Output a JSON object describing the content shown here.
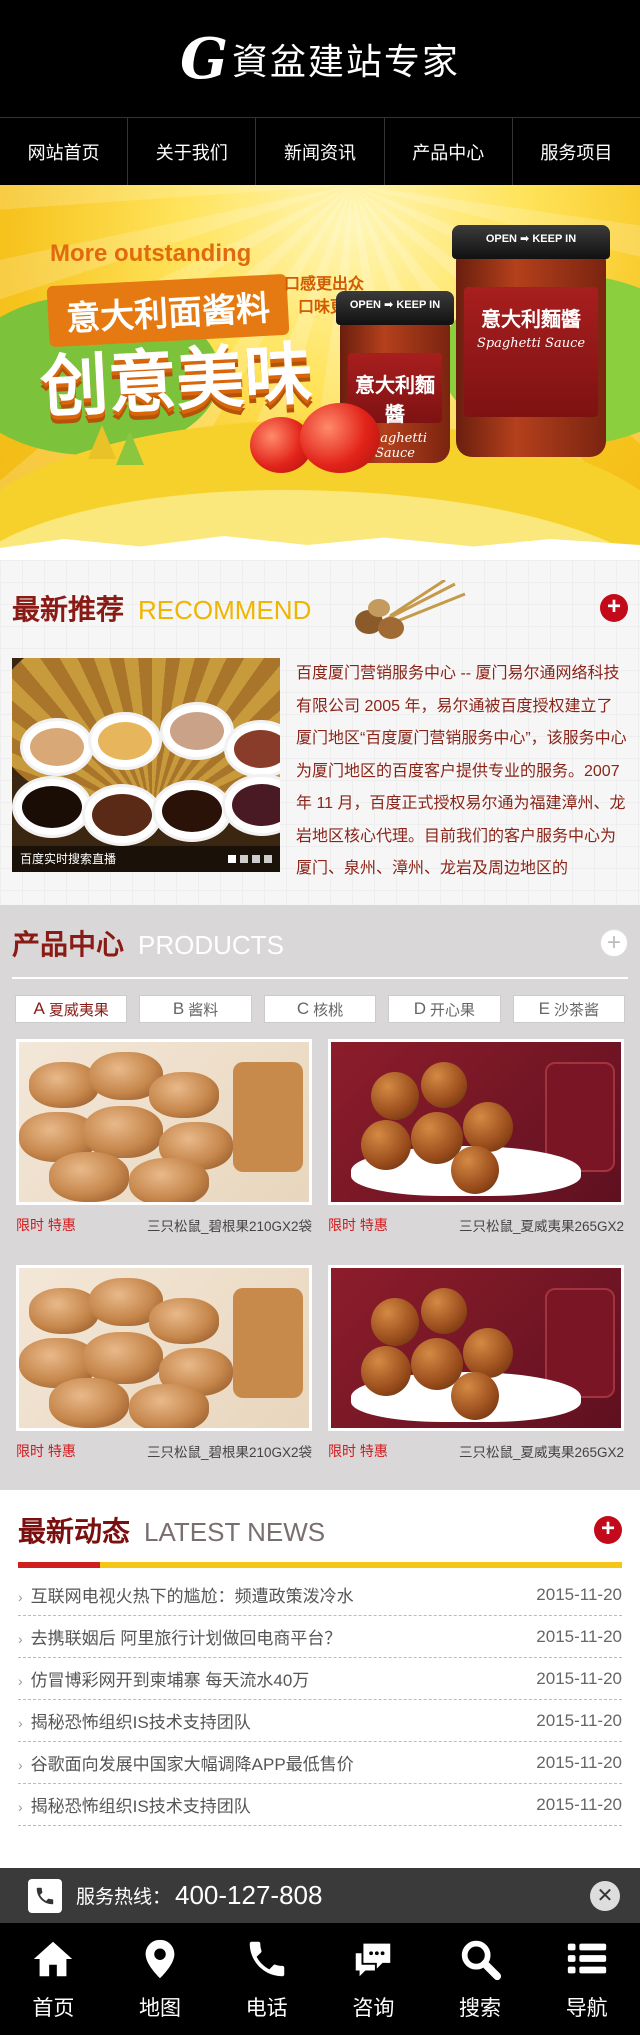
{
  "header": {
    "logo_g": "G",
    "logo_text": "資盆建站专家"
  },
  "nav": [
    {
      "label": "网站首页"
    },
    {
      "label": "关于我们"
    },
    {
      "label": "新闻资讯"
    },
    {
      "label": "产品中心"
    },
    {
      "label": "服务项目"
    }
  ],
  "banner": {
    "en": "More outstanding",
    "title": "意大利面酱料",
    "big": "创意美味",
    "tag1": "口感更出众",
    "tag2": "口味更鲜美",
    "jar_lid": "OPEN ➡ KEEP IN",
    "jar_cn": "意大利麵醬",
    "jar_en": "Spaghetti Sauce"
  },
  "recommend": {
    "title_cn": "最新推荐",
    "title_en": "RECOMMEND",
    "more": "+",
    "caption": "百度实时搜索直播",
    "text": "百度厦门营销服务中心 -- 厦门易尔通网络科技有限公司 2005 年，易尔通被百度授权建立了厦门地区“百度厦门营销服务中心”，该服务中心为厦门地区的百度客户提供专业的服务。2007 年 11 月，百度正式授权易尔通为福建漳州、龙岩地区核心代理。目前我们的客户服务中心为厦门、泉州、漳州、龙岩及周边地区的"
  },
  "products": {
    "title_cn": "产品中心",
    "title_en": "PRODUCTS",
    "more": "+",
    "tabs": [
      {
        "letter": "A",
        "label": "夏威夷果"
      },
      {
        "letter": "B",
        "label": "酱料"
      },
      {
        "letter": "C",
        "label": "核桃"
      },
      {
        "letter": "D",
        "label": "开心果"
      },
      {
        "letter": "E",
        "label": "沙茶酱"
      }
    ],
    "items": [
      {
        "promo": "限时 特惠",
        "name": "三只松鼠_碧根果210GX2袋"
      },
      {
        "promo": "限时 特惠",
        "name": "三只松鼠_夏威夷果265GX2"
      },
      {
        "promo": "限时 特惠",
        "name": "三只松鼠_碧根果210GX2袋"
      },
      {
        "promo": "限时 特惠",
        "name": "三只松鼠_夏威夷果265GX2"
      }
    ]
  },
  "news": {
    "title_cn": "最新动态",
    "title_en": "LATEST NEWS",
    "more": "+",
    "items": [
      {
        "title": "互联网电视火热下的尴尬：频遭政策泼冷水",
        "date": "2015-11-20"
      },
      {
        "title": "去携联姻后 阿里旅行计划做回电商平台？",
        "date": "2015-11-20"
      },
      {
        "title": "仿冒博彩网开到柬埔寨 每天流水40万",
        "date": "2015-11-20"
      },
      {
        "title": "揭秘恐怖组织IS技术支持团队",
        "date": "2015-11-20"
      },
      {
        "title": "谷歌面向发展中国家大幅调降APP最低售价",
        "date": "2015-11-20"
      },
      {
        "title": "揭秘恐怖组织IS技术支持团队",
        "date": "2015-11-20"
      }
    ]
  },
  "hotline": {
    "label": "服务热线：",
    "number": "400-127-808",
    "close": "✕"
  },
  "bottombar": [
    {
      "label": "首页",
      "icon": "home-icon"
    },
    {
      "label": "地图",
      "icon": "map-pin-icon"
    },
    {
      "label": "电话",
      "icon": "phone-icon"
    },
    {
      "label": "咨询",
      "icon": "chat-icon"
    },
    {
      "label": "搜索",
      "icon": "search-icon"
    },
    {
      "label": "导航",
      "icon": "menu-icon"
    }
  ]
}
